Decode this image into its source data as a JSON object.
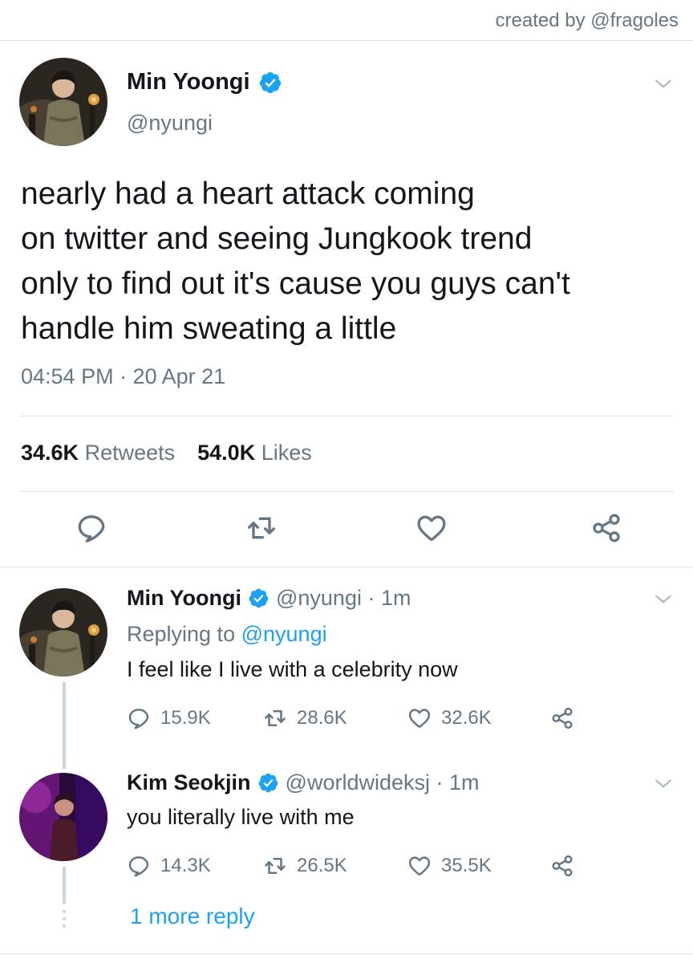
{
  "credit": "created by @fragoles",
  "main_tweet": {
    "name": "Min Yoongi",
    "handle": "@nyungi",
    "text_lines": [
      "nearly had a heart attack coming",
      "on twitter and seeing Jungkook trend",
      "only to find out it's cause you guys can't",
      "handle him sweating a little"
    ],
    "timestamp": "04:54 PM · 20 Apr 21",
    "retweets_count": "34.6K",
    "retweets_label": "Retweets",
    "likes_count": "54.0K",
    "likes_label": "Likes"
  },
  "replies": [
    {
      "name": "Min Yoongi",
      "meta": "@nyungi · 1m",
      "replying_prefix": "Replying to",
      "replying_to": "@nyungi",
      "text": "I feel like I live with a celebrity now",
      "reply_count": "15.9K",
      "retweet_count": "28.6K",
      "like_count": "32.6K"
    },
    {
      "name": "Kim Seokjin",
      "meta": "@worldwideksj · 1m",
      "text": "you literally live with me",
      "reply_count": "14.3K",
      "retweet_count": "26.5K",
      "like_count": "35.5K"
    }
  ],
  "more_reply": "1 more reply",
  "colors": {
    "accent": "#1da1f2",
    "secondary_text": "#657786",
    "divider": "#e1e8ed",
    "icon": "#657786"
  },
  "icons": [
    "verified-icon",
    "chevron-down-icon",
    "reply-icon",
    "retweet-icon",
    "like-icon",
    "share-icon"
  ]
}
